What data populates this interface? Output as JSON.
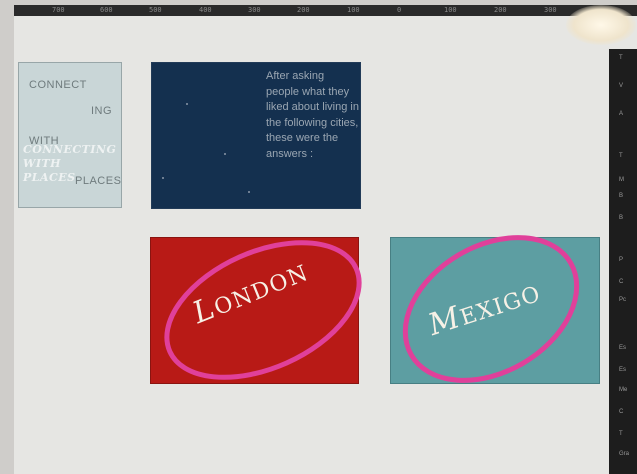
{
  "ruler": {
    "ticks": [
      "700",
      "600",
      "500",
      "400",
      "300",
      "200",
      "100",
      "0",
      "100",
      "200",
      "300"
    ]
  },
  "side_panel": {
    "letters": [
      "T",
      "V",
      "A",
      "T",
      "M",
      "B",
      "B",
      "P",
      "C",
      "Pc",
      "Es",
      "Es",
      "Me",
      "C",
      "T",
      "Gra"
    ]
  },
  "connecting_card": {
    "words": [
      "CONNECT",
      "ING",
      "WITH",
      "PLACES"
    ],
    "overlay_lines": [
      "CONNECTING",
      "WITH",
      "PLACES"
    ]
  },
  "intro_card": {
    "text": "After asking people what they liked about living in the following cities, these were the answers :"
  },
  "london_card": {
    "first": "L",
    "rest": "ONDON"
  },
  "mexico_card": {
    "first": "M",
    "rest": "EXIGO"
  },
  "colors": {
    "navy": "#14304f",
    "red": "#b81a16",
    "teal": "#5d9ea2",
    "highlight": "#e0409a"
  }
}
